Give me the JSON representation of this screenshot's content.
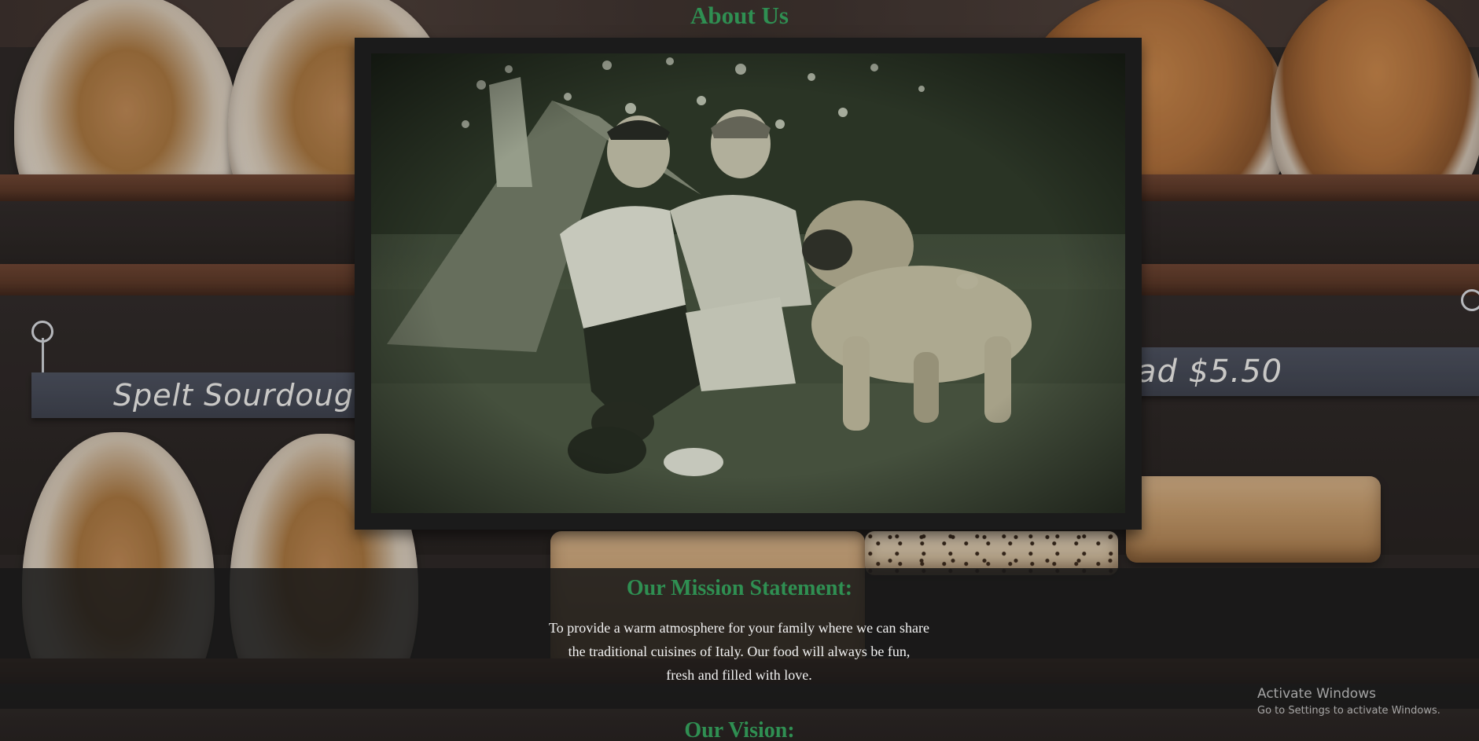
{
  "about": {
    "title": "About Us"
  },
  "photo": {
    "icon": "vintage-photo-two-men-and-bulldog"
  },
  "background": {
    "sign_left": "Spelt Sourdough $",
    "sign_right": "ad $5.50"
  },
  "mission": {
    "title": "Our Mission Statement:",
    "text_line1": "To provide a warm atmosphere for your family where we can share",
    "text_line2": "the traditional cuisines of Italy. Our food will always be fun,",
    "text_line3": "fresh and filled with love."
  },
  "vision": {
    "title": "Our Vision:"
  },
  "watermark": {
    "title": "Activate Windows",
    "subtitle": "Go to Settings to activate Windows."
  },
  "colors": {
    "heading_green": "#2f8f52",
    "band": "#181818",
    "frame": "#1b1b1b"
  }
}
